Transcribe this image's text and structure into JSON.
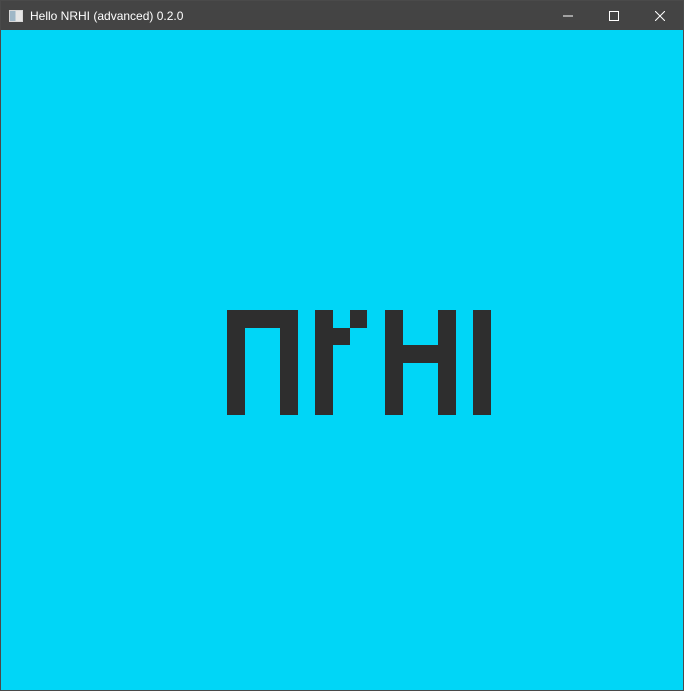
{
  "window": {
    "title": "Hello NRHI (advanced) 0.2.0",
    "app_icon": "app-window-icon",
    "controls": [
      {
        "name": "minimize-button",
        "icon": "minimize-icon"
      },
      {
        "name": "maximize-button",
        "icon": "maximize-icon"
      },
      {
        "name": "close-button",
        "icon": "close-icon"
      }
    ]
  },
  "content": {
    "background_color": "#00d6f7",
    "logo_text": "NRHI",
    "logo_color": "#2e2e2e"
  }
}
